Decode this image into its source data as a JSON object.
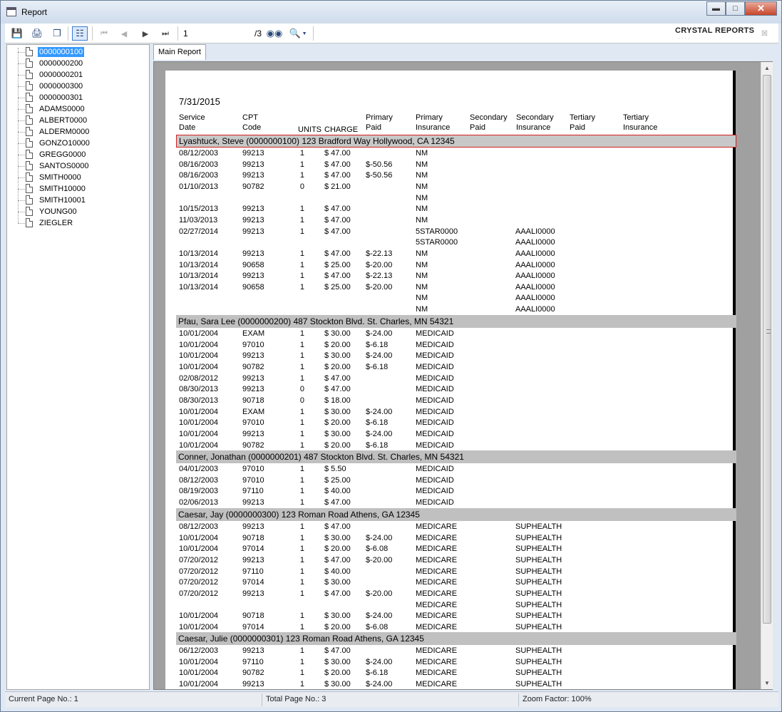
{
  "window": {
    "title": "Report"
  },
  "toolbar": {
    "page_value": "1",
    "page_total": "/3",
    "brand": "CRYSTAL REPORTS"
  },
  "tree": {
    "items": [
      "0000000100",
      "0000000200",
      "0000000201",
      "0000000300",
      "0000000301",
      "ADAMS0000",
      "ALBERT0000",
      "ALDERM0000",
      "GONZO10000",
      "GREGG0000",
      "SANTOS0000",
      "SMITH0000",
      "SMITH10000",
      "SMITH10001",
      "YOUNG00",
      "ZIEGLER"
    ],
    "selected_index": 0
  },
  "tabs": {
    "main": "Main Report"
  },
  "report": {
    "date": "7/31/2015",
    "columns": [
      {
        "l1": "Service",
        "l2": "Date"
      },
      {
        "l1": "CPT",
        "l2": "Code"
      },
      {
        "l1": "",
        "l2": "UNITS"
      },
      {
        "l1": "",
        "l2": "CHARGE"
      },
      {
        "l1": "Primary",
        "l2": "Paid"
      },
      {
        "l1": "Primary",
        "l2": "Insurance"
      },
      {
        "l1": "Secondary",
        "l2": "Paid"
      },
      {
        "l1": "Secondary",
        "l2": "Insurance"
      },
      {
        "l1": "Tertiary",
        "l2": "Paid"
      },
      {
        "l1": "Tertiary",
        "l2": "Insurance"
      }
    ],
    "groups": [
      {
        "header": "Lyashtuck, Steve (0000000100)  123 Bradford Way Hollywood, CA 12345",
        "rows": [
          [
            "08/12/2003",
            "99213",
            "1",
            "$ 47.00",
            "",
            "NM",
            ""
          ],
          [
            "08/16/2003",
            "99213",
            "1",
            "$ 47.00",
            "$-50.56",
            "NM",
            ""
          ],
          [
            "08/16/2003",
            "99213",
            "1",
            "$ 47.00",
            "$-50.56",
            "NM",
            ""
          ],
          [
            "01/10/2013",
            "90782",
            "0",
            "$ 21.00",
            "",
            "NM",
            ""
          ],
          [
            "",
            "",
            "",
            "",
            "",
            "NM",
            ""
          ],
          [
            "10/15/2013",
            "99213",
            "1",
            "$ 47.00",
            "",
            "NM",
            ""
          ],
          [
            "11/03/2013",
            "99213",
            "1",
            "$ 47.00",
            "",
            "NM",
            ""
          ],
          [
            "02/27/2014",
            "99213",
            "1",
            "$ 47.00",
            "",
            "5STAR0000",
            "AAALI0000"
          ],
          [
            "",
            "",
            "",
            "",
            "",
            "5STAR0000",
            "AAALI0000"
          ],
          [
            "10/13/2014",
            "99213",
            "1",
            "$ 47.00",
            "$-22.13",
            "NM",
            "AAALI0000"
          ],
          [
            "10/13/2014",
            "90658",
            "1",
            "$ 25.00",
            "$-20.00",
            "NM",
            "AAALI0000"
          ],
          [
            "10/13/2014",
            "99213",
            "1",
            "$ 47.00",
            "$-22.13",
            "NM",
            "AAALI0000"
          ],
          [
            "10/13/2014",
            "90658",
            "1",
            "$ 25.00",
            "$-20.00",
            "NM",
            "AAALI0000"
          ],
          [
            "",
            "",
            "",
            "",
            "",
            "NM",
            "AAALI0000"
          ],
          [
            "",
            "",
            "",
            "",
            "",
            "NM",
            "AAALI0000"
          ]
        ]
      },
      {
        "header": "Pfau, Sara Lee (0000000200)  487 Stockton Blvd. St. Charles, MN 54321",
        "rows": [
          [
            "10/01/2004",
            "EXAM",
            "1",
            "$ 30.00",
            "$-24.00",
            "MEDICAID",
            ""
          ],
          [
            "10/01/2004",
            "97010",
            "1",
            "$ 20.00",
            "$-6.18",
            "MEDICAID",
            ""
          ],
          [
            "10/01/2004",
            "99213",
            "1",
            "$ 30.00",
            "$-24.00",
            "MEDICAID",
            ""
          ],
          [
            "10/01/2004",
            "90782",
            "1",
            "$ 20.00",
            "$-6.18",
            "MEDICAID",
            ""
          ],
          [
            "02/08/2012",
            "99213",
            "1",
            "$ 47.00",
            "",
            "MEDICAID",
            ""
          ],
          [
            "08/30/2013",
            "99213",
            "0",
            "$ 47.00",
            "",
            "MEDICAID",
            ""
          ],
          [
            "08/30/2013",
            "90718",
            "0",
            "$ 18.00",
            "",
            "MEDICAID",
            ""
          ],
          [
            "10/01/2004",
            "EXAM",
            "1",
            "$ 30.00",
            "$-24.00",
            "MEDICAID",
            ""
          ],
          [
            "10/01/2004",
            "97010",
            "1",
            "$ 20.00",
            "$-6.18",
            "MEDICAID",
            ""
          ],
          [
            "10/01/2004",
            "99213",
            "1",
            "$ 30.00",
            "$-24.00",
            "MEDICAID",
            ""
          ],
          [
            "10/01/2004",
            "90782",
            "1",
            "$ 20.00",
            "$-6.18",
            "MEDICAID",
            ""
          ]
        ]
      },
      {
        "header": "Conner, Jonathan (0000000201)  487 Stockton Blvd. St. Charles, MN 54321",
        "rows": [
          [
            "04/01/2003",
            "97010",
            "1",
            "$ 5.50",
            "",
            "MEDICAID",
            ""
          ],
          [
            "08/12/2003",
            "97010",
            "1",
            "$ 25.00",
            "",
            "MEDICAID",
            ""
          ],
          [
            "08/19/2003",
            "97110",
            "1",
            "$ 40.00",
            "",
            "MEDICAID",
            ""
          ],
          [
            "02/06/2013",
            "99213",
            "1",
            "$ 47.00",
            "",
            "MEDICAID",
            ""
          ]
        ]
      },
      {
        "header": "Caesar, Jay (0000000300)  123 Roman Road Athens, GA 12345",
        "rows": [
          [
            "08/12/2003",
            "99213",
            "1",
            "$ 47.00",
            "",
            "MEDICARE",
            "SUPHEALTH"
          ],
          [
            "10/01/2004",
            "90718",
            "1",
            "$ 30.00",
            "$-24.00",
            "MEDICARE",
            "SUPHEALTH"
          ],
          [
            "10/01/2004",
            "97014",
            "1",
            "$ 20.00",
            "$-6.08",
            "MEDICARE",
            "SUPHEALTH"
          ],
          [
            "07/20/2012",
            "99213",
            "1",
            "$ 47.00",
            "$-20.00",
            "MEDICARE",
            "SUPHEALTH"
          ],
          [
            "07/20/2012",
            "97110",
            "1",
            "$ 40.00",
            "",
            "MEDICARE",
            "SUPHEALTH"
          ],
          [
            "07/20/2012",
            "97014",
            "1",
            "$ 30.00",
            "",
            "MEDICARE",
            "SUPHEALTH"
          ],
          [
            "07/20/2012",
            "99213",
            "1",
            "$ 47.00",
            "$-20.00",
            "MEDICARE",
            "SUPHEALTH"
          ],
          [
            "",
            "",
            "",
            "",
            "",
            "MEDICARE",
            "SUPHEALTH"
          ],
          [
            "10/01/2004",
            "90718",
            "1",
            "$ 30.00",
            "$-24.00",
            "MEDICARE",
            "SUPHEALTH"
          ],
          [
            "10/01/2004",
            "97014",
            "1",
            "$ 20.00",
            "$-6.08",
            "MEDICARE",
            "SUPHEALTH"
          ]
        ]
      },
      {
        "header": "Caesar, Julie (0000000301)  123 Roman Road Athens, GA 12345",
        "rows": [
          [
            "06/12/2003",
            "99213",
            "1",
            "$ 47.00",
            "",
            "MEDICARE",
            "SUPHEALTH"
          ],
          [
            "10/01/2004",
            "97110",
            "1",
            "$ 30.00",
            "$-24.00",
            "MEDICARE",
            "SUPHEALTH"
          ],
          [
            "10/01/2004",
            "90782",
            "1",
            "$ 20.00",
            "$-6.18",
            "MEDICARE",
            "SUPHEALTH"
          ],
          [
            "10/01/2004",
            "99213",
            "1",
            "$ 30.00",
            "$-24.00",
            "MEDICARE",
            "SUPHEALTH"
          ]
        ]
      }
    ]
  },
  "status": {
    "current_page": "Current Page No.: 1",
    "total_page": "Total Page No.: 3",
    "zoom": "Zoom Factor: 100%"
  },
  "colors": {
    "selection": "#3399ff",
    "group_band": "#c0c0c0",
    "highlight_border": "#d42020"
  }
}
